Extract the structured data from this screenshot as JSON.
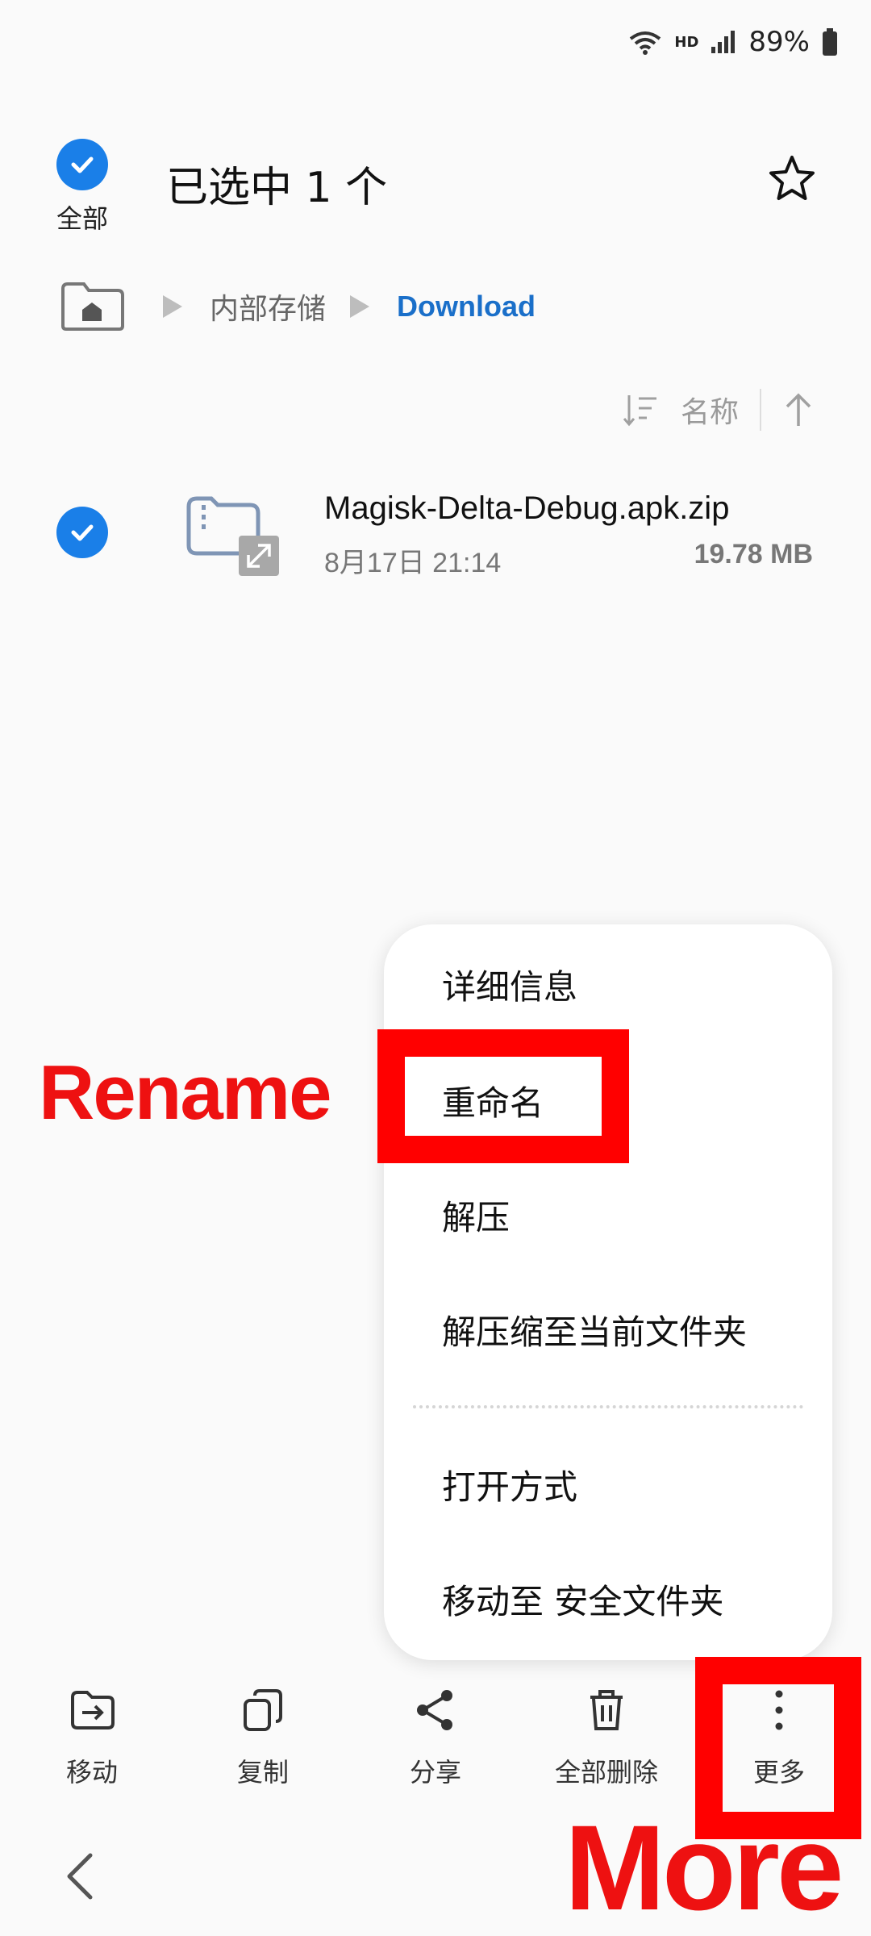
{
  "status_bar": {
    "hd": "HD",
    "battery": "89%"
  },
  "header": {
    "select_all_label": "全部",
    "title": "已选中 1 个"
  },
  "breadcrumb": {
    "items": [
      "内部存储",
      "Download"
    ]
  },
  "sort": {
    "label": "名称"
  },
  "file": {
    "name": "Magisk-Delta-Debug.apk.zip",
    "date": "8月17日 21:14",
    "size": "19.78 MB"
  },
  "menu": {
    "items": [
      "详细信息",
      "重命名",
      "解压",
      "解压缩至当前文件夹",
      "打开方式",
      "移动至 安全文件夹"
    ]
  },
  "toolbar": {
    "items": [
      {
        "label": "移动",
        "icon": "move-icon"
      },
      {
        "label": "复制",
        "icon": "copy-icon"
      },
      {
        "label": "分享",
        "icon": "share-icon"
      },
      {
        "label": "全部删除",
        "icon": "trash-icon"
      },
      {
        "label": "更多",
        "icon": "more-vertical-icon"
      }
    ]
  },
  "annotations": {
    "rename": "Rename",
    "more": "More"
  },
  "colors": {
    "accent": "#1a7fe8",
    "annotation": "#ff0000",
    "breadcrumb_active": "#1a6fc9"
  }
}
